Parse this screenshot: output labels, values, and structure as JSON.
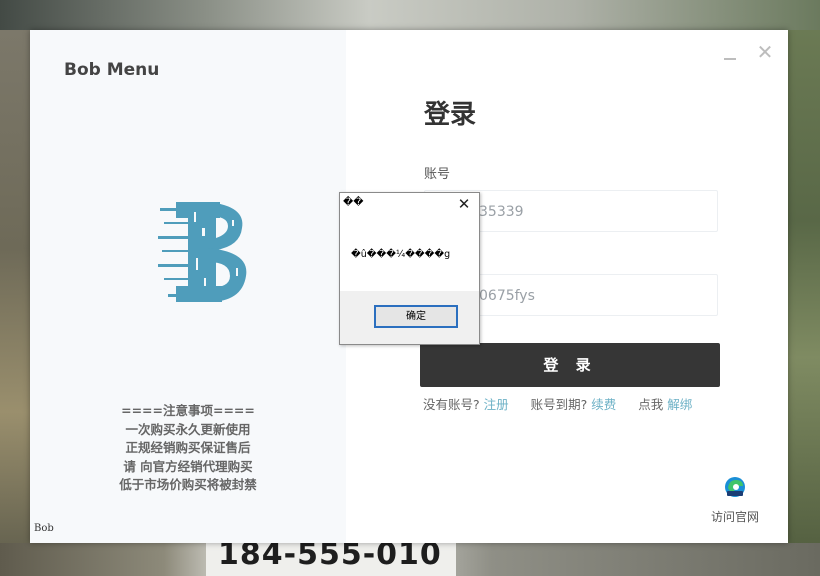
{
  "background": {
    "sign_text": "184-555-010"
  },
  "window": {
    "title": "Bob Menu",
    "logo_letter": "B",
    "footer_tag": "Bob",
    "notice_lines": [
      "====注意事项====",
      "一次购买永久更新使用",
      "正规经销购买保证售后",
      "请 向官方经销代理购买",
      "低于市场价购买将被封禁"
    ],
    "login_title": "登录",
    "account_label": "账号",
    "account_value": "35339",
    "password_value": "0675fys",
    "login_button": "登 录",
    "links": {
      "no_account": "没有账号?",
      "register": "注册",
      "expired": "账号到期?",
      "renew": "续费",
      "click_me": "点我",
      "unbind": "解绑"
    },
    "visit_site": "访问官网",
    "close_glyph": "✕"
  },
  "msgbox": {
    "title": "��",
    "message": "�û���¼����g",
    "ok_button": "确定",
    "close_glyph": "✕"
  },
  "colors": {
    "logo_blue": "#4f9dbb",
    "link": "#6db1c6",
    "button_dark": "#363636",
    "focus_border": "#2b6fbf"
  },
  "icons": [
    "minimize-icon",
    "close-icon",
    "edge-browser-icon",
    "bob-logo"
  ]
}
